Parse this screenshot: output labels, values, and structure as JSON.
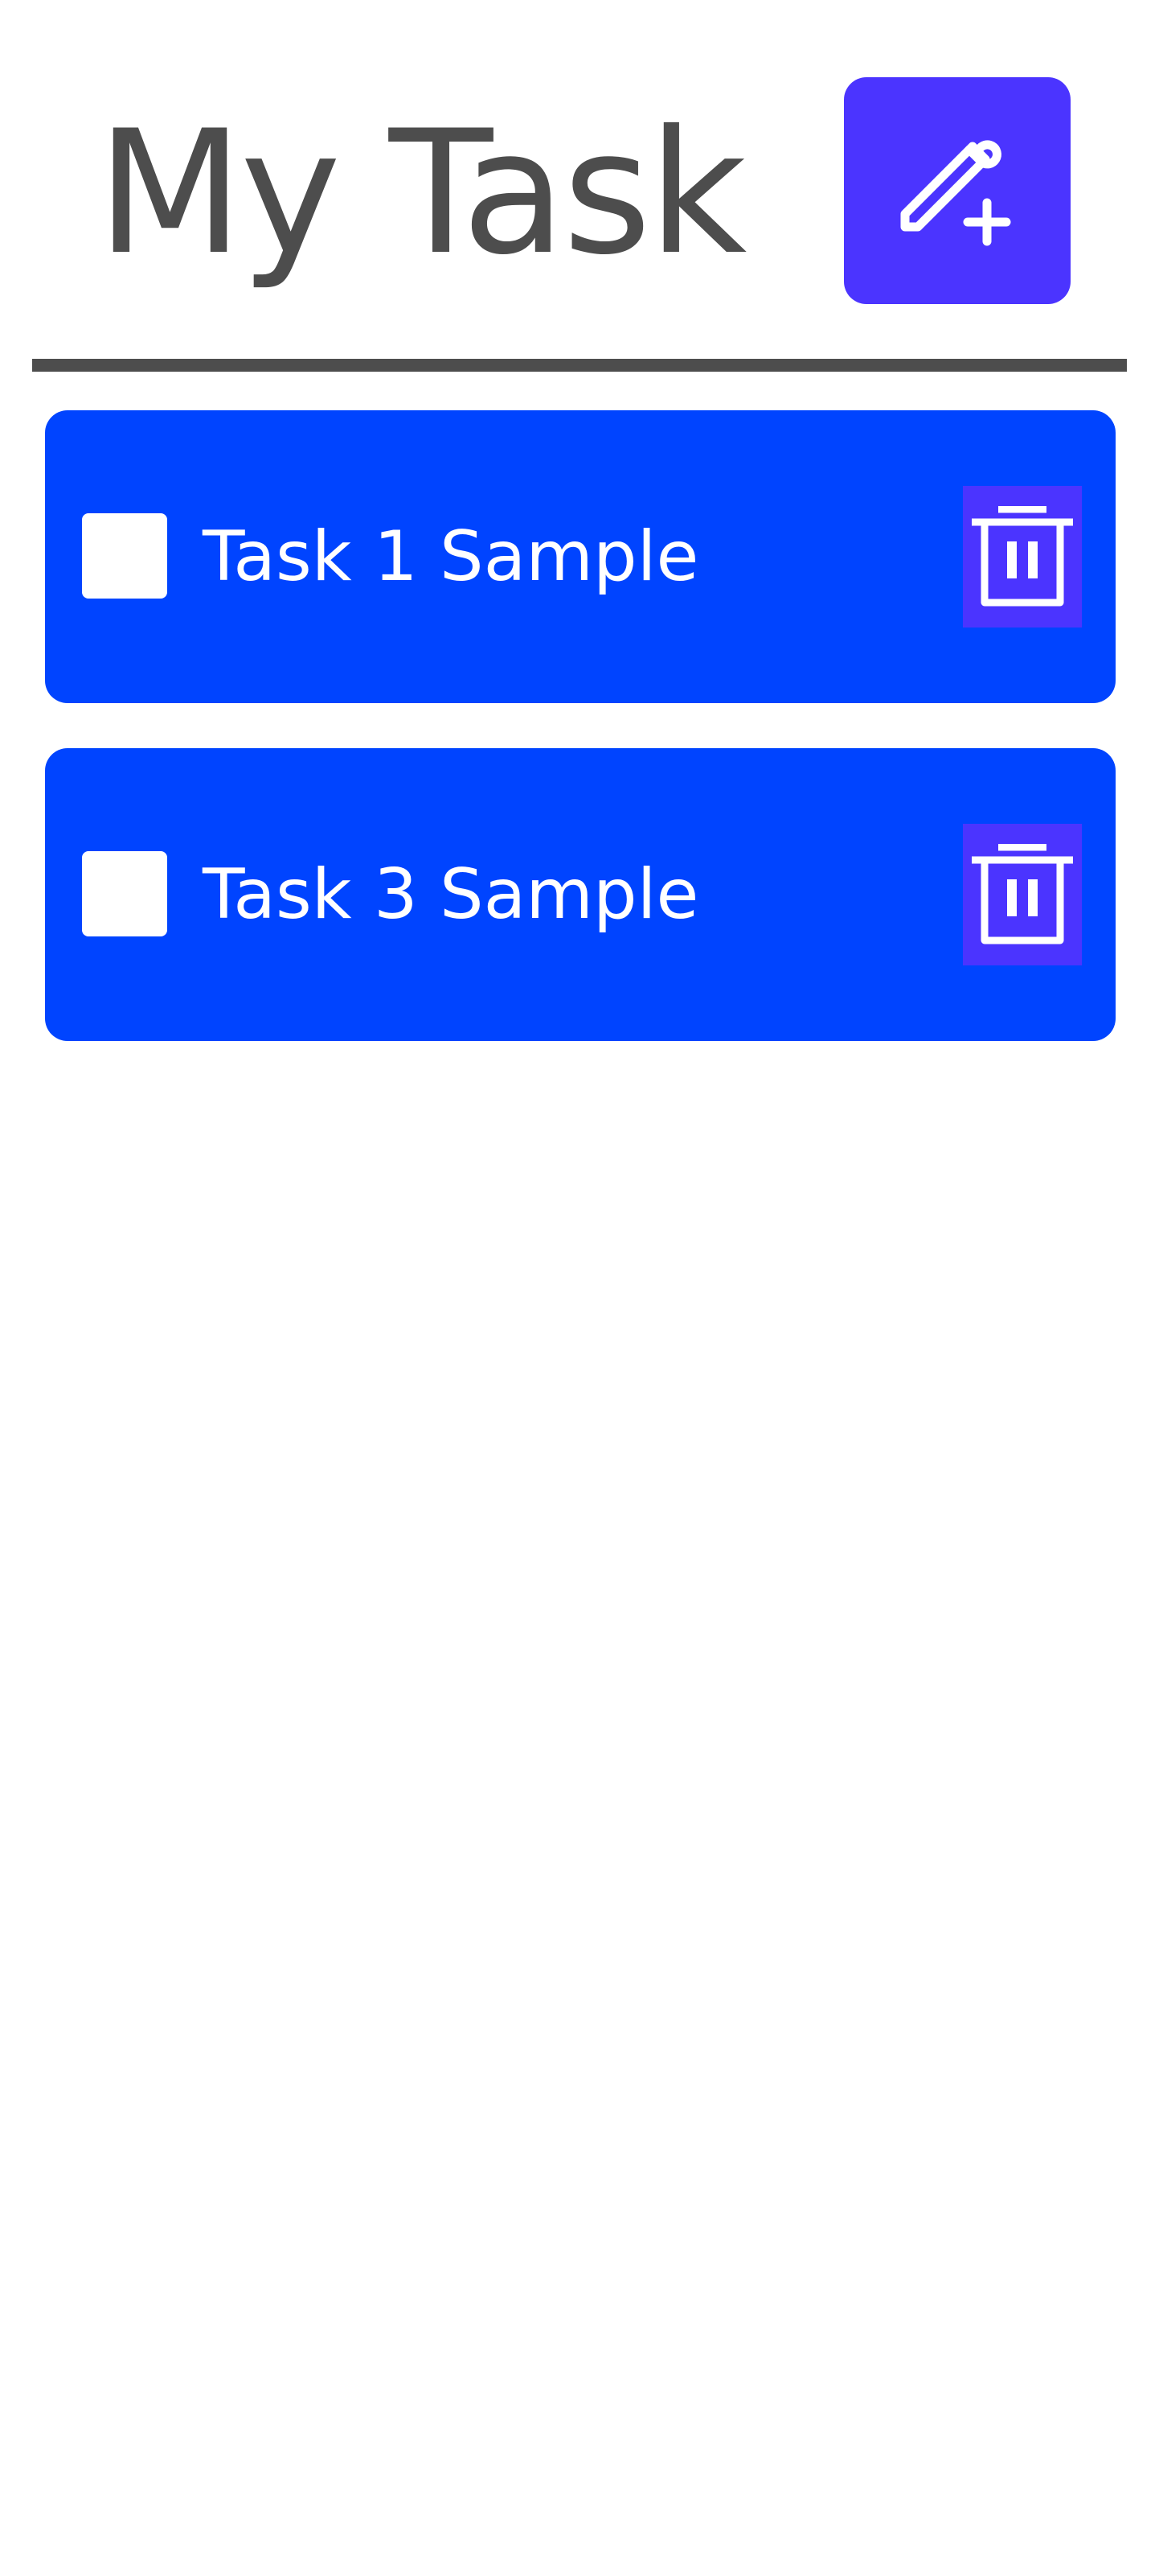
{
  "header": {
    "title": "My Task",
    "add_button_icon": "edit-plus-icon"
  },
  "tasks": [
    {
      "label": "Task 1 Sample",
      "checked": false,
      "delete_icon": "trash-icon",
      "color": "#0044ff"
    },
    {
      "label": "Task 3 Sample",
      "checked": false,
      "delete_icon": "trash-icon",
      "color": "#0044ff"
    }
  ],
  "colors": {
    "accent": "#4b34ff",
    "task_background": "#0044ff",
    "text_dark": "#4d4d4d",
    "text_light": "#ffffff"
  }
}
